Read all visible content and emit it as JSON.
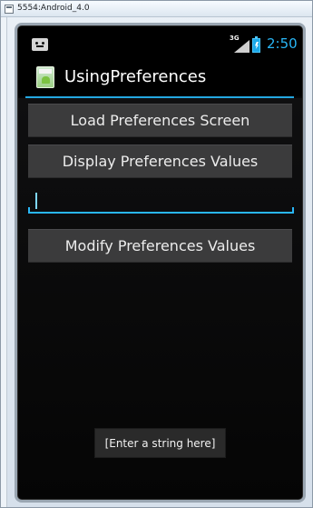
{
  "window": {
    "title": "5554:Android_4.0"
  },
  "status_bar": {
    "network_label": "3G",
    "time": "2:50",
    "icons": {
      "notification": "notification-icon",
      "signal": "signal-icon",
      "battery": "battery-charging-icon"
    },
    "colors": {
      "clock": "#29b6f6",
      "battery": "#1ba8e8"
    }
  },
  "app_bar": {
    "title": "UsingPreferences",
    "icon": "app-icon",
    "accent_color": "#24a7e0"
  },
  "main": {
    "buttons": [
      {
        "label": "Load Preferences Screen"
      },
      {
        "label": "Display Preferences Values"
      },
      {
        "label": "Modify Preferences Values"
      }
    ],
    "input": {
      "value": ""
    }
  },
  "toast": {
    "text": "[Enter a string here]"
  }
}
